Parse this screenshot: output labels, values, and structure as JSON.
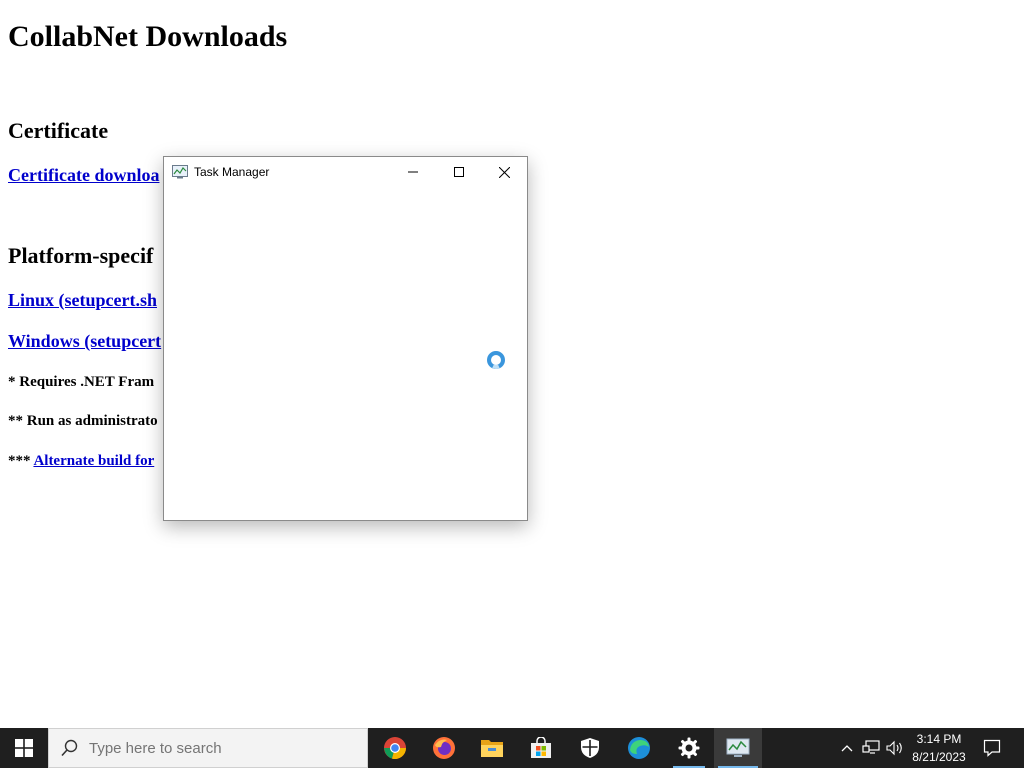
{
  "page": {
    "title": "CollabNet Downloads",
    "certificate_heading": "Certificate",
    "certificate_link": "Certificate downloa",
    "platform_heading": "Platform-specif",
    "linux_link": "Linux (setupcert.sh",
    "windows_link": "Windows (setupcert",
    "note_net": "* Requires .NET Fram",
    "note_admin": "** Run as administrato",
    "note_alt_prefix": "***",
    "note_alt_link": "Alternate build for"
  },
  "task_manager": {
    "title": "Task Manager",
    "status": "loading"
  },
  "taskbar": {
    "search_placeholder": "Type here to search",
    "apps": [
      "chrome-icon",
      "firefox-icon",
      "file-explorer-icon",
      "microsoft-store-icon",
      "windows-security-icon",
      "edge-icon",
      "settings-icon",
      "task-manager-icon"
    ],
    "clock": {
      "time": "3:14 PM",
      "date": "8/21/2023"
    }
  },
  "colors": {
    "link": "#0000cc",
    "taskbar": "#1f1f1f",
    "accent": "#76b9ed",
    "spinner": "#3a96dd"
  }
}
